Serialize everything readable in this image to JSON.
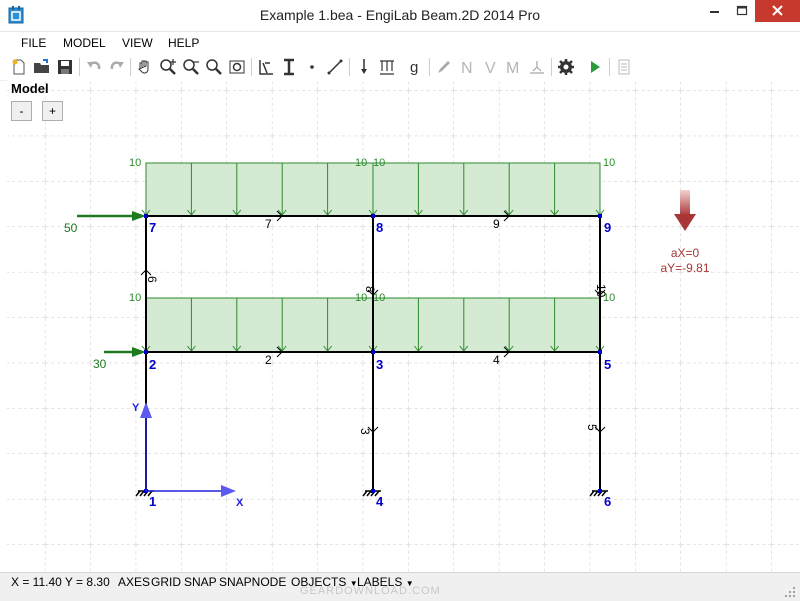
{
  "window": {
    "title": "Example 1.bea - EngiLab Beam.2D 2014 Pro",
    "minimize_icon": "minimize-icon",
    "maximize_icon": "maximize-icon",
    "close_icon": "close-icon"
  },
  "menu": {
    "file": "FILE",
    "model": "MODEL",
    "view": "VIEW",
    "help": "HELP"
  },
  "toolbar": {
    "icons": [
      "new-file-icon",
      "open-folder-icon",
      "save-icon",
      "undo-icon",
      "redo-icon",
      "pan-hand-icon",
      "zoom-in-icon",
      "zoom-out-icon",
      "zoom-window-icon",
      "zoom-extents-icon",
      "section-properties-icon",
      "beam-profile-icon",
      "node-icon",
      "element-line-icon",
      "point-load-icon",
      "distributed-load-icon",
      "gravity-icon",
      "edit-pencil-icon",
      "normal-force-icon",
      "shear-force-icon",
      "moment-icon",
      "support-icon",
      "settings-gear-icon",
      "run-play-icon",
      "report-icon"
    ],
    "labels": {
      "n": "N",
      "v": "V",
      "m": "M",
      "g": "g"
    }
  },
  "panel": {
    "title": "Model",
    "zoom_out": "-",
    "zoom_in": "+"
  },
  "model": {
    "nodes": [
      {
        "id": "1",
        "label": "1"
      },
      {
        "id": "2",
        "label": "2"
      },
      {
        "id": "3",
        "label": "3"
      },
      {
        "id": "4",
        "label": "4"
      },
      {
        "id": "5",
        "label": "5"
      },
      {
        "id": "6",
        "label": "6"
      },
      {
        "id": "7",
        "label": "7"
      },
      {
        "id": "8",
        "label": "8"
      },
      {
        "id": "9",
        "label": "9"
      }
    ],
    "element_labels": [
      "2",
      "4",
      "3",
      "5",
      "7",
      "9",
      "6",
      "8",
      "10"
    ],
    "distributed_load_values": [
      "10",
      "10",
      "10",
      "10",
      "10",
      "10",
      "10",
      "10"
    ],
    "point_loads": [
      {
        "node": "7",
        "value": "50"
      },
      {
        "node": "2",
        "value": "30"
      }
    ],
    "axes": {
      "x": "X",
      "y": "Y"
    },
    "gravity": {
      "ax": "aX=0",
      "ay": "aY=-9.81"
    },
    "colors": {
      "member": "#000000",
      "node": "#0000cc",
      "load_fill": "#d4ead2",
      "load_stroke": "#2e8b2e",
      "point_load": "#1e7a1e",
      "gravity": "#b03030",
      "axis": "#2222dd"
    }
  },
  "status": {
    "coords": "X = 11.40  Y = 8.30",
    "axes": "AXES",
    "grid": "GRID",
    "snap": "SNAP",
    "snapnode": "SNAPNODE",
    "objects": "OBJECTS",
    "labels": "LABELS"
  },
  "watermark": "GEARDOWNLOAD.COM"
}
